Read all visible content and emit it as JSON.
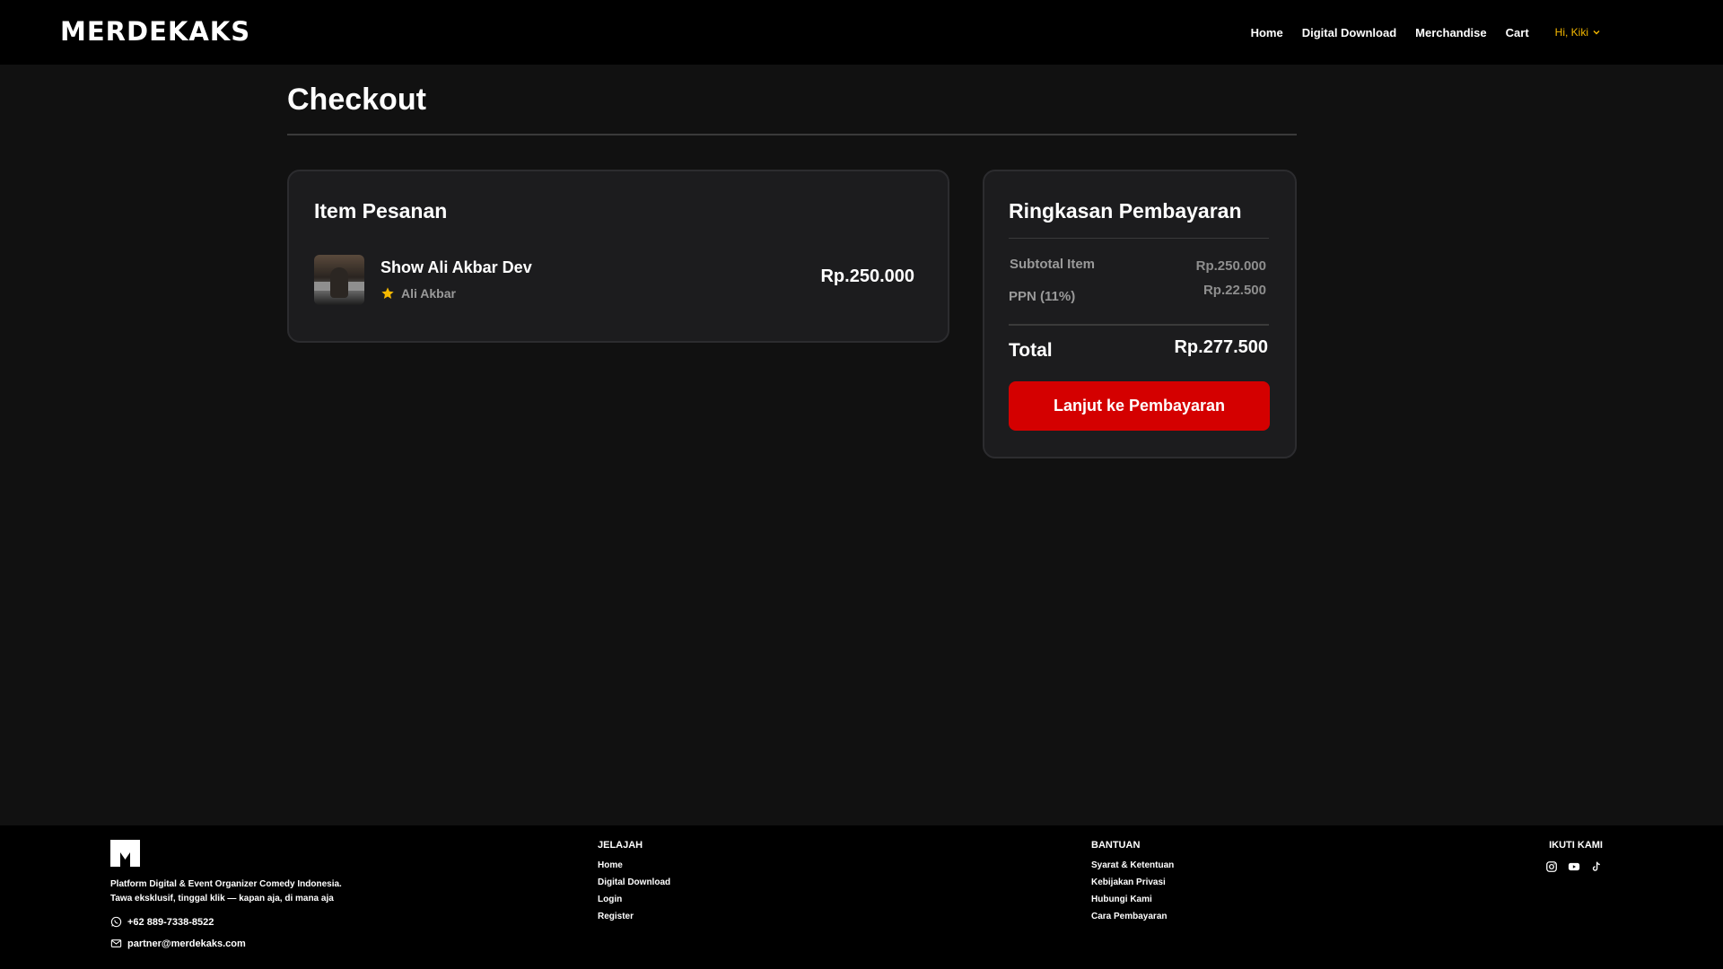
{
  "header": {
    "logo": "MERDEKAKS",
    "nav": [
      "Home",
      "Digital Download",
      "Merchandise",
      "Cart"
    ],
    "user_label": "Hi, Kiki"
  },
  "main": {
    "title": "Checkout",
    "items_card": {
      "title": "Item Pesanan",
      "items": [
        {
          "name": "Show Ali Akbar Dev",
          "performer": "Ali Akbar",
          "price": "Rp.250.000"
        }
      ]
    },
    "summary_card": {
      "title": "Ringkasan Pembayaran",
      "subtotal_label": "Subtotal Item",
      "subtotal_value": "Rp.250.000",
      "ppn_label": "PPN (11%)",
      "ppn_value": "Rp.22.500",
      "total_label": "Total",
      "total_value": "Rp.277.500",
      "pay_button": "Lanjut ke Pembayaran"
    }
  },
  "footer": {
    "tagline_1": "Platform Digital & Event Organizer Comedy Indonesia.",
    "tagline_2": "Tawa eksklusif, tinggal klik — kapan aja, di mana aja",
    "phone": "+62 889-7338-8522",
    "email": "partner@merdekaks.com",
    "jelajah": {
      "title": "JELAJAH",
      "links": [
        "Home",
        "Digital Download",
        "Login",
        "Register"
      ]
    },
    "bantuan": {
      "title": "BANTUAN",
      "links": [
        "Syarat & Ketentuan",
        "Kebijakan Privasi",
        "Hubungi Kami",
        "Cara Pembayaran"
      ]
    },
    "ikuti": {
      "title": "IKUTI KAMI",
      "icons": [
        "instagram-icon",
        "youtube-icon",
        "tiktok-icon"
      ]
    }
  },
  "colors": {
    "accent_red": "#d40000",
    "user_yellow": "#f5b800",
    "star": "#f5b800",
    "background": "#111111",
    "card": "#1c1c1e"
  }
}
